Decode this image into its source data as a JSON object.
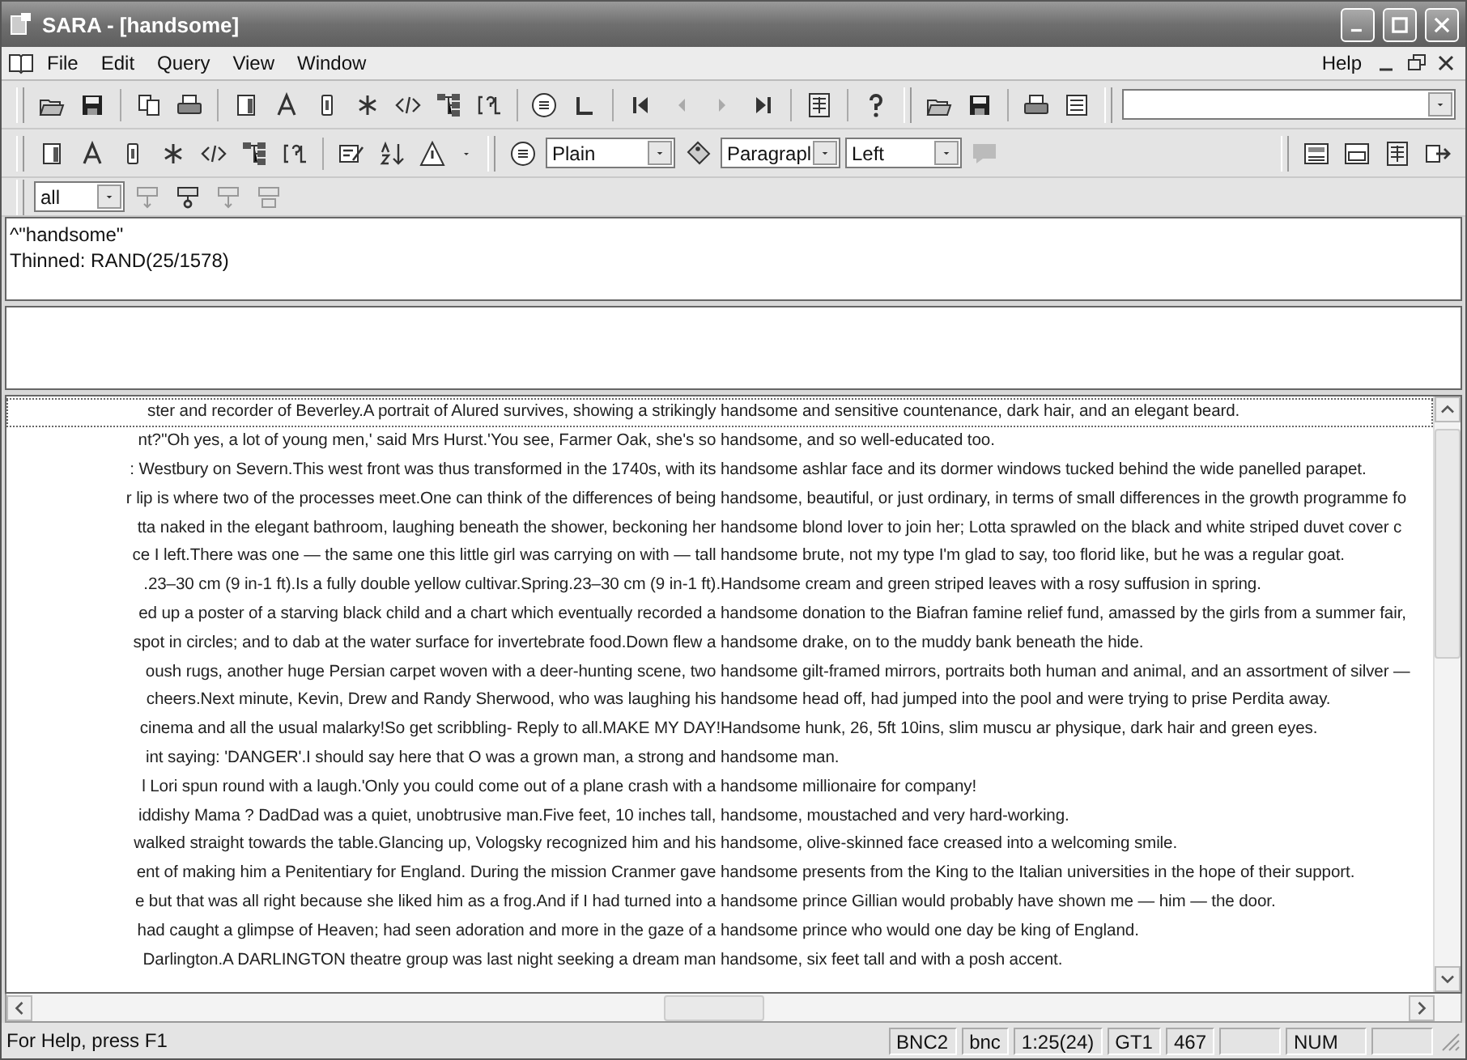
{
  "window": {
    "title": "SARA - [handsome]"
  },
  "menu": {
    "items": [
      "File",
      "Edit",
      "Query",
      "View",
      "Window"
    ],
    "help": "Help"
  },
  "format_bar": {
    "style": "Plain",
    "unit": "Paragrapl",
    "align": "Left"
  },
  "filter": {
    "value": "all"
  },
  "query": {
    "lines": [
      "^\"handsome\"",
      "Thinned: RAND(25/1578)"
    ]
  },
  "concordance": {
    "lines": [
      {
        "left": "ster and recorder of Beverley.A portrait of Alured survives, showing a strikingly ",
        "keyword": "handsome",
        "right": " and sensitive countenance, dark hair, and an elegant beard.",
        "selected": true
      },
      {
        "left": "nt?''Oh yes, a lot of young men,' said Mrs Hurst.'You see, Farmer Oak, she's so ",
        "keyword": "handsome",
        "right": ", and so well-educated too.",
        "selected": false
      },
      {
        "left": ": Westbury on Severn.This west front was thus transformed in the 1740s, with its ",
        "keyword": "handsome",
        "right": " ashlar face and its dormer windows tucked behind the wide panelled parapet.",
        "selected": false
      },
      {
        "left": "r lip is where two of the processes meet.One can think of the differences of being ",
        "keyword": "handsome",
        "right": ", beautiful, or just ordinary, in terms of small differences in the growth programme fo",
        "selected": false
      },
      {
        "left": "tta naked in the elegant bathroom, laughing beneath the shower, beckoning her ",
        "keyword": "handsome",
        "right": " blond lover to join her; Lotta sprawled on the black and white striped duvet cover c",
        "selected": false
      },
      {
        "left": "ce I left.There was one — the same one this little girl was carrying on with — tall ",
        "keyword": "handsome",
        "right": " brute, not my type I'm glad to say, too florid like, but he was a regular goat.",
        "selected": false
      },
      {
        "left": ".23–30 cm (9 in-1 ft).Is a fully double yellow cultivar.Spring.23–30 cm (9 in-1 ft).",
        "keyword": "Handsome",
        "right": " cream and green striped leaves with a rosy suffusion in spring.",
        "selected": false
      },
      {
        "left": "ed up a poster of a starving black child and a chart which eventually recorded a ",
        "keyword": "handsome",
        "right": " donation to the Biafran famine relief fund, amassed by the girls from a summer fair,",
        "selected": false
      },
      {
        "left": "spot in circles; and to dab at the water surface for invertebrate food.Down flew a ",
        "keyword": "handsome",
        "right": " drake, on to the muddy bank beneath the hide.",
        "selected": false
      },
      {
        "left": "oush rugs, another huge Persian carpet woven with a deer-hunting scene, two ",
        "keyword": "handsome",
        "right": " gilt-framed mirrors, portraits both human and animal, and an assortment of silver —",
        "selected": false
      },
      {
        "left": "cheers.Next minute, Kevin, Drew and Randy Sherwood, who was laughing his ",
        "keyword": "handsome",
        "right": " head off, had jumped into the pool and were trying to prise Perdita away.",
        "selected": false
      },
      {
        "left": "cinema and all the usual malarky!So get scribbling- Reply to all.MAKE MY DAY!",
        "keyword": "Handsome",
        "right": " hunk, 26, 5ft 10ins, slim muscu ar physique, dark hair and green eyes.",
        "selected": false
      },
      {
        "left": "int saying: 'DANGER'.I should say here that O was a grown man, a strong and ",
        "keyword": "handsome",
        "right": " man.",
        "selected": false
      },
      {
        "left": "l Lori spun round with a laugh.'Only you could come out of a plane crash with a ",
        "keyword": "handsome",
        "right": " millionaire for company!",
        "selected": false
      },
      {
        "left": "iddishy Mama ? DadDad was a quiet, unobtrusive man.Five feet, 10 inches tall, ",
        "keyword": "handsome",
        "right": ", moustached and very hard-working.",
        "selected": false
      },
      {
        "left": "walked straight towards the table.Glancing up, Vologsky recognized him and his ",
        "keyword": "handsome",
        "right": ", olive-skinned face creased into a welcoming smile.",
        "selected": false
      },
      {
        "left": "ent of making him a Penitentiary for England. During the mission Cranmer gave ",
        "keyword": "handsome",
        "right": " presents from the King to the Italian universities in the hope of their support.",
        "selected": false
      },
      {
        "left": "e but that was all right because she liked him as a frog.And if I had turned into a ",
        "keyword": "handsome",
        "right": " prince Gillian would probably have shown me — him — the door.",
        "selected": false
      },
      {
        "left": "had caught a glimpse of Heaven; had seen adoration and more in the gaze of a ",
        "keyword": "handsome",
        "right": " prince who would one day be king of England.",
        "selected": false
      },
      {
        "left": " Darlington.A DARLINGTON theatre group was last night seeking a dream man ",
        "keyword": "handsome",
        "right": ", six feet tall and with a posh accent.",
        "selected": false
      }
    ]
  },
  "status_bar": {
    "message": "For Help, press F1",
    "panes": [
      "BNC2",
      "bnc",
      "1:25(24)",
      "GT1",
      "467"
    ],
    "indicators": [
      "NUM"
    ]
  }
}
